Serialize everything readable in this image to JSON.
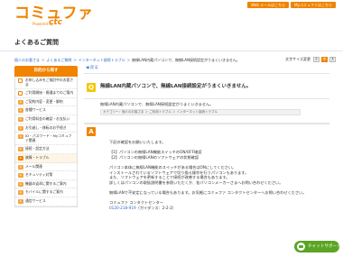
{
  "header": {
    "logo": "コミュファ",
    "logo_sub": "Powered by",
    "logo_brand": "ctc",
    "top_links": [
      "Web メールはこちら",
      "Myコミュファはこちら"
    ],
    "page_heading": "よくあるご質問"
  },
  "breadcrumb": {
    "items": [
      "個人のお客さま",
      "よくあるご質問",
      "インターネット接続トラブル"
    ],
    "current": "無線LAN内蔵パソコンで、無線LAN接続設定がうまくいきません。"
  },
  "text_size": {
    "label": "文字サイズ変更",
    "options": [
      "小",
      "中",
      "大"
    ],
    "selected": "中"
  },
  "sidebar": {
    "title": "目的から探す",
    "items": [
      {
        "label": "お申し込みをご検討中のお客さま",
        "type": "plain"
      },
      {
        "label": "ご利用開始・開通までのご案内",
        "type": "plain"
      },
      {
        "label": "ご契約内容・変更・解約",
        "type": "main"
      },
      {
        "label": "各種サービス",
        "type": "main"
      },
      {
        "label": "ご利用料金の確認・お支払い",
        "type": "main"
      },
      {
        "label": "お引越し・移転のお手続き",
        "type": "main"
      },
      {
        "label": "ID・パスワード・Myコミュファ関連",
        "type": "main"
      },
      {
        "label": "接続・設定方法",
        "type": "main"
      },
      {
        "label": "故障・トラブル",
        "type": "sub"
      },
      {
        "label": "メール関連",
        "type": "main"
      },
      {
        "label": "セキュリティ対策",
        "type": "main"
      },
      {
        "label": "機器の返却に関するご案内",
        "type": "main"
      },
      {
        "label": "モバイルに関するご案内",
        "type": "main"
      },
      {
        "label": "通信サービス",
        "type": "main"
      }
    ]
  },
  "main": {
    "back_link": "戻る",
    "question_badge": "Q",
    "question_title": "無線LAN内蔵パソコンで、無線LAN接続設定がうまくいきません。",
    "question_text": "無線LAN内蔵パソコンで、無線LAN接続設定がうまくいきません。",
    "category": "カテゴリー：個人のお客さま ＞ ご利用トラブル ＞ インターネット接続トラブル",
    "answer_badge": "A",
    "answer": {
      "intro": "下記の確認をお願いいたします。",
      "checks": [
        "【1】パソコンの無線LAN機能スイッチのON/OFF確認",
        "【2】パソコンの無線LANのソフトウェアの状態確認"
      ],
      "details": [
        "パソコン本体に無線LAN機能のスイッチがある場合はONにしてください。",
        "インストールされているソフトウェアで切り換え操作を行うパソコンもあります。",
        "また、ソフトウェアを更新することで接続が改善する場合もあります。",
        "詳しくはパソコンの取扱説明書を参照いただくか、各パソコンメーカーさまへお問い合わせください。"
      ],
      "followup": "無線LANで不安定になっている場合もあります。お気軽にコミュファ コンタクトセンターへお問い合わせください。",
      "center_name": "コミュファ コンタクトセンター",
      "phone": "0120-218-919",
      "hours": "（ガイダンス：2-2-2）"
    }
  },
  "chat": {
    "label": "チャットサポート"
  }
}
